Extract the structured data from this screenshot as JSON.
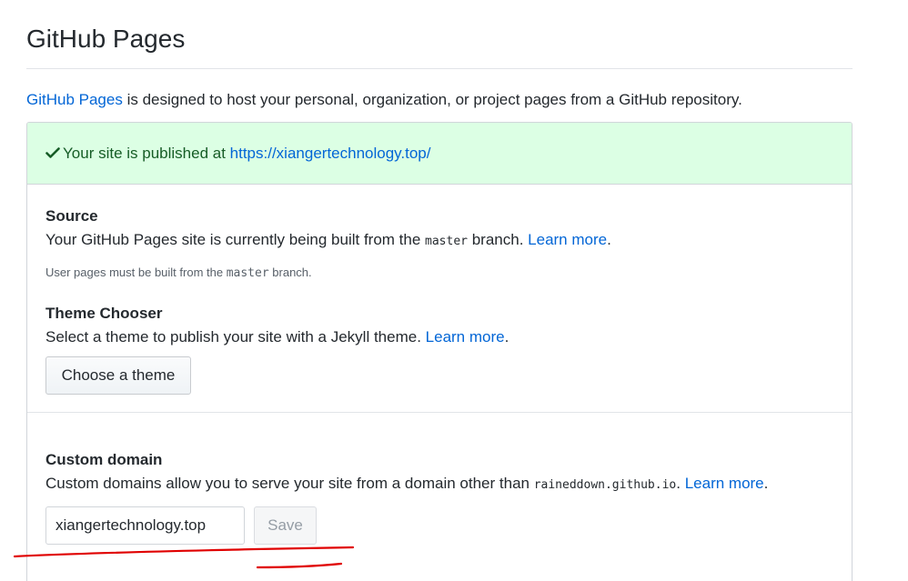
{
  "page": {
    "title": "GitHub Pages"
  },
  "intro": {
    "link_text": "GitHub Pages",
    "text": " is designed to host your personal, organization, or project pages from a GitHub repository."
  },
  "flash": {
    "prefix": "Your site is published at ",
    "url": "https://xiangertechnology.top/",
    "status_color": "#28a745"
  },
  "source": {
    "heading": "Source",
    "desc_before": "Your GitHub Pages site is currently being built from the ",
    "branch": "master",
    "desc_after": " branch. ",
    "learn_more": "Learn more",
    "period": ".",
    "note_before": "User pages must be built from the ",
    "note_branch": "master",
    "note_after": " branch."
  },
  "theme": {
    "heading": "Theme Chooser",
    "desc": "Select a theme to publish your site with a Jekyll theme. ",
    "learn_more": "Learn more",
    "period": ".",
    "button_label": "Choose a theme"
  },
  "custom_domain": {
    "heading": "Custom domain",
    "desc_before": "Custom domains allow you to serve your site from a domain other than ",
    "domain": "raineddown.github.io",
    "desc_after": ". ",
    "learn_more": "Learn more",
    "period": ".",
    "input_value": "xiangertechnology.top",
    "save_label": "Save"
  },
  "colors": {
    "link": "#0366d6",
    "flash_bg": "#dcffe4",
    "annotation": "#e00000"
  }
}
